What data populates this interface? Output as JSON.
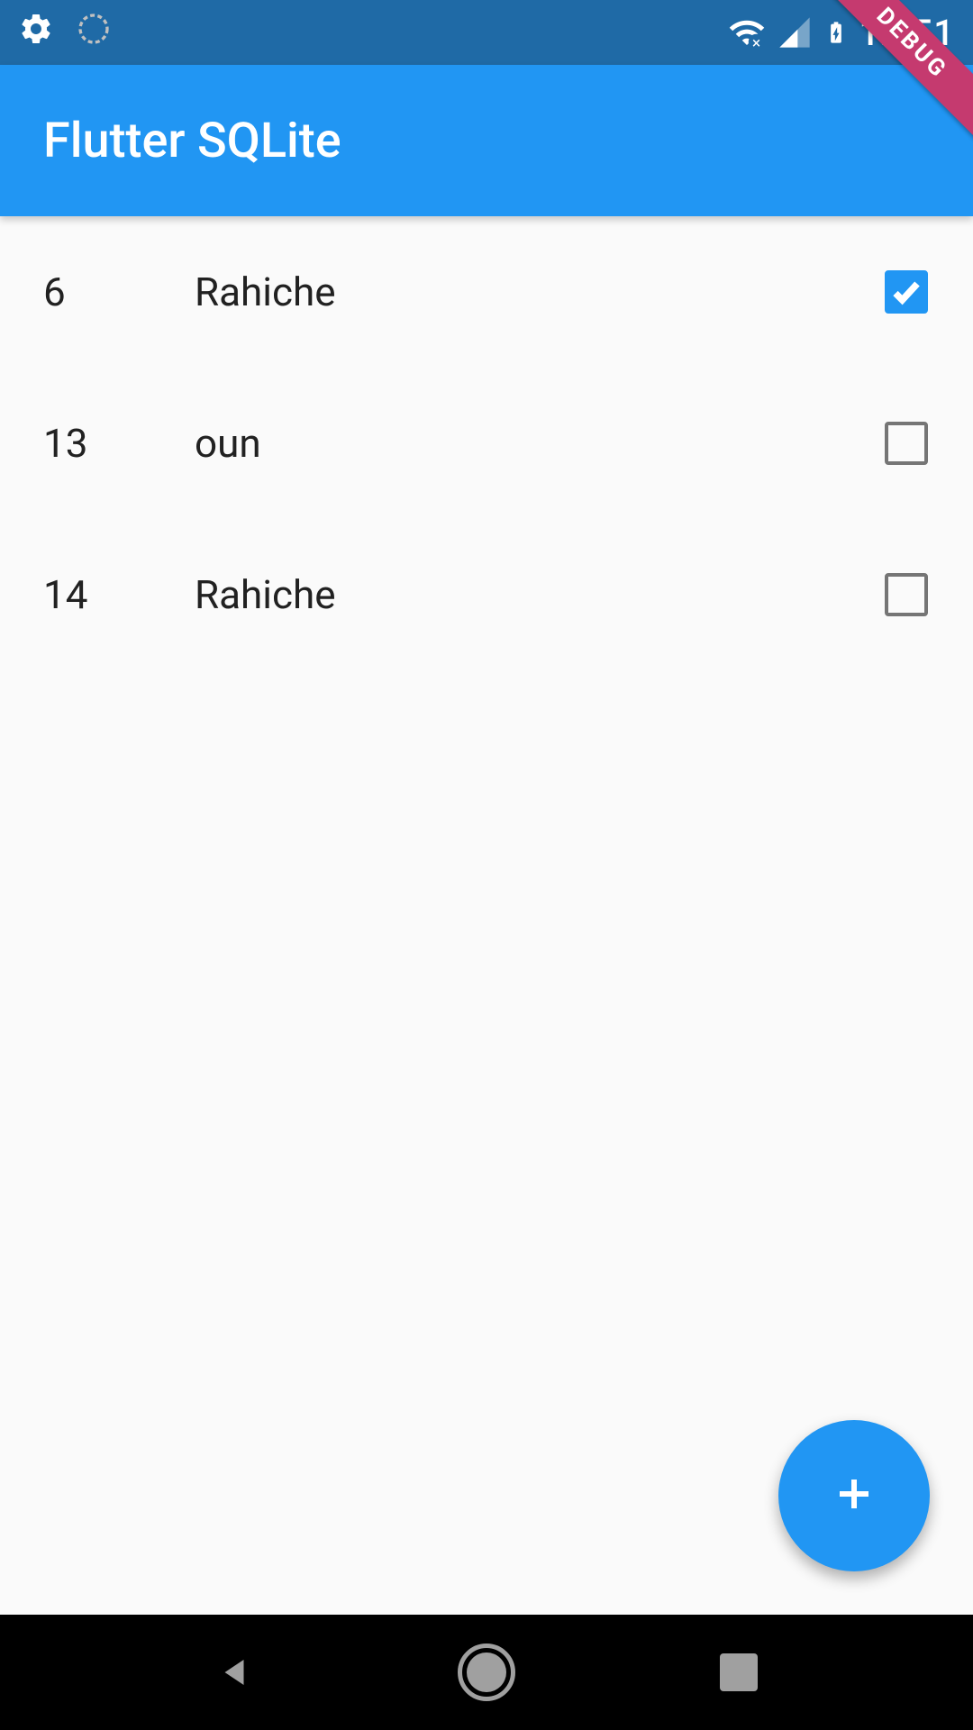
{
  "statusBar": {
    "time": "12:51"
  },
  "debugRibbon": {
    "label": "DEBUG"
  },
  "appBar": {
    "title": "Flutter SQLite"
  },
  "list": {
    "items": [
      {
        "id": "6",
        "name": "Rahiche",
        "checked": true
      },
      {
        "id": "13",
        "name": "oun",
        "checked": false
      },
      {
        "id": "14",
        "name": "Rahiche",
        "checked": false
      }
    ]
  }
}
